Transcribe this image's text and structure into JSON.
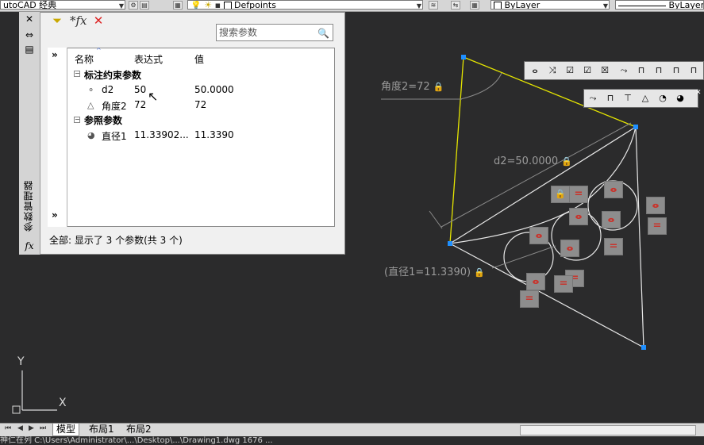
{
  "toolbar": {
    "workspace": "utoCAD 经典",
    "layer_name": "Defpoints",
    "color_value": "ByLayer",
    "linetype_value": "ByLayer"
  },
  "palette": {
    "title": "参数管理器",
    "search_placeholder": "搜索参数",
    "columns": {
      "name": "名称",
      "expression": "表达式",
      "value": "值"
    },
    "groups": [
      {
        "label": "标注约束参数",
        "rows": [
          {
            "name": "d2",
            "expression": "50",
            "value": "50.0000"
          },
          {
            "name": "角度2",
            "expression": "72",
            "value": "72"
          }
        ]
      },
      {
        "label": "参照参数",
        "rows": [
          {
            "name": "直径1",
            "expression": "11.33902...",
            "value": "11.3390"
          }
        ]
      }
    ],
    "status": "全部: 显示了 3 个参数(共 3 个)"
  },
  "drawing": {
    "angle_label": "角度2=72",
    "dist_label": "d2=50.0000",
    "diam_label": "(直径1=11.3390)",
    "equal_symbol": "="
  },
  "ucs": {
    "y": "Y",
    "x": "X"
  },
  "tabs": [
    "模型",
    "布局1",
    "布局2"
  ],
  "command_line": "神仁在列 C:\\Users\\Administrator\\...\\Desktop\\...\\Drawing1.dwg  1676 ..."
}
